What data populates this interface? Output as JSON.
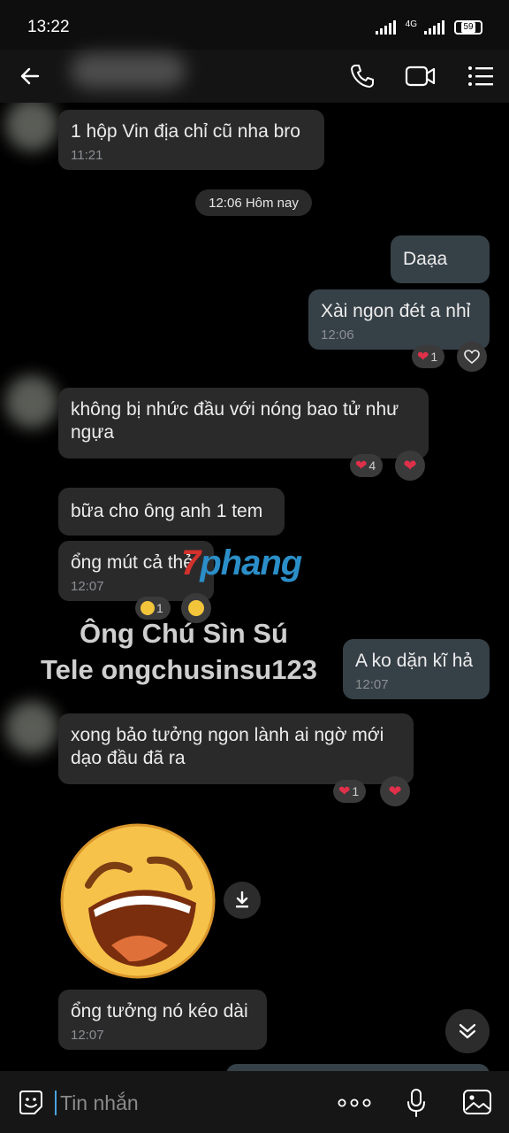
{
  "status_bar": {
    "time": "13:22",
    "network": "4G",
    "battery": "59"
  },
  "date_separator": "12:06 Hôm nay",
  "messages": [
    {
      "text": "1 hộp Vin địa chỉ cũ nha bro",
      "time": "11:21"
    },
    {
      "text": "Daạa"
    },
    {
      "text": "Xài ngon đét a nhỉ",
      "time": "12:06",
      "reaction_count": "1"
    },
    {
      "text": "không bị nhức đầu với nóng bao tử như ngựa",
      "reaction_count": "4"
    },
    {
      "text": "bữa cho ông anh 1 tem"
    },
    {
      "text": "ổng mút cả thẻ",
      "time": "12:07",
      "reaction_count": "1"
    },
    {
      "text": "A ko dặn kĩ hả",
      "time": "12:07"
    },
    {
      "text": "xong bảo tưởng ngon lành ai ngờ mới dạo đầu đã ra",
      "reaction_count": "1"
    },
    {
      "text": "ổng tưởng nó kéo dài",
      "time": "12:07"
    }
  ],
  "watermark": {
    "logo_first": "7",
    "logo_rest": "phang",
    "line1": "Ông Chú Sìn Sú",
    "line2": "Tele ongchusinsu123"
  },
  "composer": {
    "placeholder": "Tin nhắn"
  },
  "colors": {
    "background": "#000000",
    "incoming_bubble": "#2a2a2b",
    "outgoing_bubble": "#364047",
    "heart": "#e0304a"
  }
}
